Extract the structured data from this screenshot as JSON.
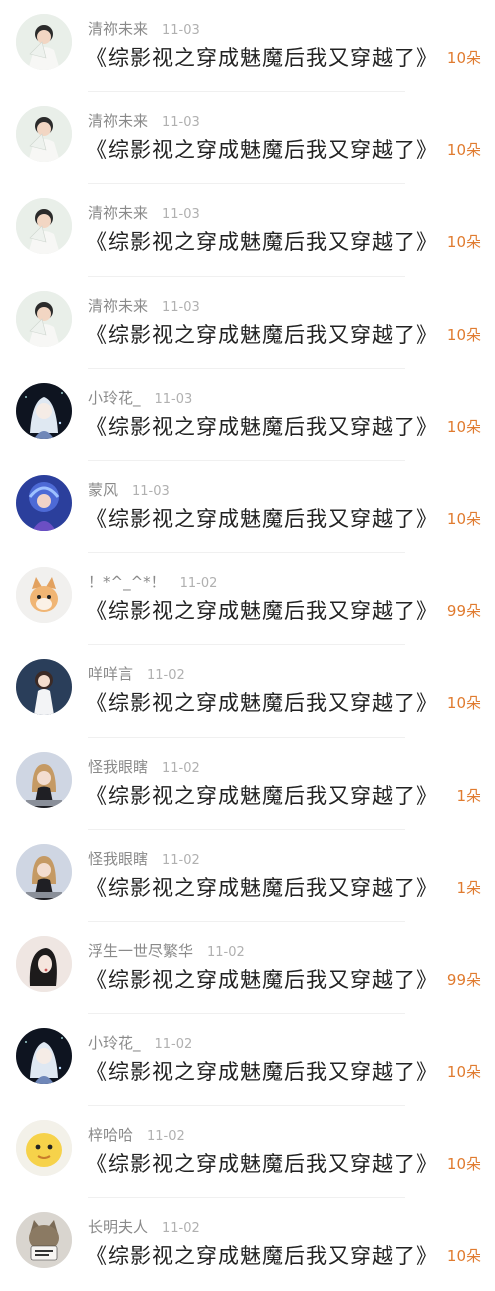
{
  "colors": {
    "amount": "#e07b2f",
    "name": "#8a8a8a",
    "date": "#b0b0b0",
    "title": "#222222"
  },
  "records": [
    {
      "name": "清祢未来",
      "date": "11-03",
      "title": "《综影视之穿成魅魔后我又穿越了》",
      "amount": "10朵",
      "avatar": "boy-fan-avatar"
    },
    {
      "name": "清祢未来",
      "date": "11-03",
      "title": "《综影视之穿成魅魔后我又穿越了》",
      "amount": "10朵",
      "avatar": "boy-fan-avatar"
    },
    {
      "name": "清祢未来",
      "date": "11-03",
      "title": "《综影视之穿成魅魔后我又穿越了》",
      "amount": "10朵",
      "avatar": "boy-fan-avatar"
    },
    {
      "name": "清祢未来",
      "date": "11-03",
      "title": "《综影视之穿成魅魔后我又穿越了》",
      "amount": "10朵",
      "avatar": "boy-fan-avatar"
    },
    {
      "name": "小玲花_",
      "date": "11-03",
      "title": "《综影视之穿成魅魔后我又穿越了》",
      "amount": "10朵",
      "avatar": "anime-white-hair-avatar"
    },
    {
      "name": "蒙风",
      "date": "11-03",
      "title": "《综影视之穿成魅魔后我又穿越了》",
      "amount": "10朵",
      "avatar": "blue-fantasy-avatar"
    },
    {
      "name": "！*^_^*！",
      "date": "11-02",
      "title": "《综影视之穿成魅魔后我又穿越了》",
      "amount": "99朵",
      "avatar": "cat-avatar"
    },
    {
      "name": "咩咩言",
      "date": "11-02",
      "title": "《综影视之穿成魅魔后我又穿越了》",
      "amount": "10朵",
      "avatar": "girl-night-avatar"
    },
    {
      "name": "怪我眼瞎",
      "date": "11-02",
      "title": "《综影视之穿成魅魔后我又穿越了》",
      "amount": "1朵",
      "avatar": "doll-avatar"
    },
    {
      "name": "怪我眼瞎",
      "date": "11-02",
      "title": "《综影视之穿成魅魔后我又穿越了》",
      "amount": "1朵",
      "avatar": "doll-avatar"
    },
    {
      "name": "浮生一世尽繁华",
      "date": "11-02",
      "title": "《综影视之穿成魅魔后我又穿越了》",
      "amount": "99朵",
      "avatar": "ink-girl-avatar"
    },
    {
      "name": "小玲花_",
      "date": "11-02",
      "title": "《综影视之穿成魅魔后我又穿越了》",
      "amount": "10朵",
      "avatar": "anime-white-hair-avatar"
    },
    {
      "name": "梓哈哈",
      "date": "11-02",
      "title": "《综影视之穿成魅魔后我又穿越了》",
      "amount": "10朵",
      "avatar": "yellow-cartoon-avatar"
    },
    {
      "name": "长明夫人",
      "date": "11-02",
      "title": "《综影视之穿成魅魔后我又穿越了》",
      "amount": "10朵",
      "avatar": "cat-sign-avatar"
    }
  ]
}
